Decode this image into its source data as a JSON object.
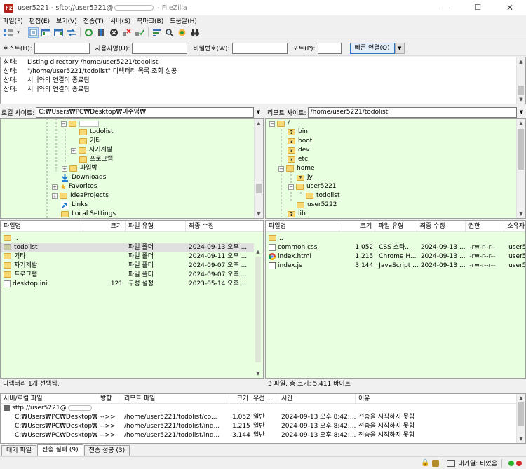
{
  "window": {
    "title_prefix": "user5221 - sftp://user5221@",
    "title_suffix": " - FileZilla",
    "minimize": "—",
    "maximize": "☐",
    "close": "✕"
  },
  "menu": [
    "파일(F)",
    "편집(E)",
    "보기(V)",
    "전송(T)",
    "서버(S)",
    "북마크(B)",
    "도움말(H)"
  ],
  "toolbar_icons": [
    "site-manager-icon",
    "toggle-log-icon",
    "toggle-local-tree-icon",
    "toggle-remote-tree-icon",
    "toggle-queue-icon",
    "refresh-icon",
    "process-queue-icon",
    "cancel-icon",
    "disconnect-icon",
    "reconnect-icon",
    "directory-filter-icon",
    "search-icon",
    "compare-icon",
    "binoculars-icon"
  ],
  "quickconnect": {
    "host_label": "호스트(H):",
    "user_label": "사용자명(U):",
    "pass_label": "비밀번호(W):",
    "port_label": "포트(P):",
    "button": "빠른 연결(Q)"
  },
  "log": [
    {
      "k": "상태:",
      "v": "Listing directory /home/user5221/todolist"
    },
    {
      "k": "상태:",
      "v": "\"/home/user5221/todolist\" 디렉터리 목록 조회 성공"
    },
    {
      "k": "상태:",
      "v": "서버와의 연결이 종료됨"
    },
    {
      "k": "상태:",
      "v": "서버와의 연결이 종료됨"
    }
  ],
  "local": {
    "site_label": "로컬 사이트:",
    "site_path": "C:₩Users₩PC₩Desktop₩이주영₩",
    "tree": [
      {
        "label": "todolist",
        "icon": "folder"
      },
      {
        "label": "기타",
        "icon": "folder"
      },
      {
        "label": "자기계발",
        "icon": "folder"
      },
      {
        "label": "프로그램",
        "icon": "folder"
      },
      {
        "label": "파일방",
        "icon": "folder"
      },
      {
        "label": "Downloads",
        "icon": "downloads"
      },
      {
        "label": "Favorites",
        "icon": "favorites"
      },
      {
        "label": "IdeaProjects",
        "icon": "folder"
      },
      {
        "label": "Links",
        "icon": "links"
      },
      {
        "label": "Local Settings",
        "icon": "folder"
      }
    ],
    "columns": [
      "파일명",
      "크기",
      "파일 유형",
      "최종 수정"
    ],
    "files": [
      {
        "name": "..",
        "size": "",
        "type": "",
        "modified": ""
      },
      {
        "name": "todolist",
        "size": "",
        "type": "파일 폴더",
        "modified": "2024-09-13 오후 ..."
      },
      {
        "name": "기타",
        "size": "",
        "type": "파일 폴더",
        "modified": "2024-09-11 오후 ..."
      },
      {
        "name": "자기계발",
        "size": "",
        "type": "파일 폴더",
        "modified": "2024-09-07 오후 ..."
      },
      {
        "name": "프로그램",
        "size": "",
        "type": "파일 폴더",
        "modified": "2024-09-07 오후 ..."
      },
      {
        "name": "desktop.ini",
        "size": "121",
        "type": "구성 설정",
        "modified": "2023-05-14 오후 ..."
      }
    ],
    "status": "디렉터리 1개 선택됨."
  },
  "remote": {
    "site_label": "리모트 사이트:",
    "site_path": "/home/user5221/todolist",
    "tree": [
      {
        "label": "/",
        "icon": "folder"
      },
      {
        "label": "bin",
        "icon": "folder-unknown"
      },
      {
        "label": "boot",
        "icon": "folder-unknown"
      },
      {
        "label": "dev",
        "icon": "folder-unknown"
      },
      {
        "label": "etc",
        "icon": "folder-unknown"
      },
      {
        "label": "home",
        "icon": "folder"
      },
      {
        "label": "jy",
        "icon": "folder-unknown"
      },
      {
        "label": "user5221",
        "icon": "folder"
      },
      {
        "label": "todolist",
        "icon": "folder"
      },
      {
        "label": "user5222",
        "icon": "folder"
      },
      {
        "label": "lib",
        "icon": "folder-unknown"
      }
    ],
    "columns": [
      "파일명",
      "크기",
      "파일 유형",
      "최종 수정",
      "권한",
      "소유자"
    ],
    "files": [
      {
        "name": "..",
        "size": "",
        "type": "",
        "modified": "",
        "perm": "",
        "owner": ""
      },
      {
        "name": "common.css",
        "size": "1,052",
        "type": "CSS 스타...",
        "modified": "2024-09-13 ...",
        "perm": "-rw-r--r--",
        "owner": "user5..."
      },
      {
        "name": "index.html",
        "size": "1,215",
        "type": "Chrome H...",
        "modified": "2024-09-13 ...",
        "perm": "-rw-r--r--",
        "owner": "user5..."
      },
      {
        "name": "index.js",
        "size": "3,144",
        "type": "JavaScript ...",
        "modified": "2024-09-13 ...",
        "perm": "-rw-r--r--",
        "owner": "user5..."
      }
    ],
    "status": "3 파일. 총 크기: 5,411 바이트"
  },
  "queue": {
    "columns": [
      "서버/로컬 파일",
      "방향",
      "리모트 파일",
      "크기",
      "우선 ...",
      "시간",
      "이유"
    ],
    "server": "sftp://user5221@",
    "rows": [
      {
        "local": "C:₩Users₩PC₩Desktop₩...",
        "dir": "-->>",
        "remote": "/home/user5221/todolist/co...",
        "size": "1,052",
        "prio": "일반",
        "time": "2024-09-13 오후 8:42:...",
        "reason": "전송을 시작하지 못함"
      },
      {
        "local": "C:₩Users₩PC₩Desktop₩...",
        "dir": "-->>",
        "remote": "/home/user5221/todolist/ind...",
        "size": "1,215",
        "prio": "일반",
        "time": "2024-09-13 오후 8:42:...",
        "reason": "전송을 시작하지 못함"
      },
      {
        "local": "C:₩Users₩PC₩Desktop₩...",
        "dir": "-->>",
        "remote": "/home/user5221/todolist/ind...",
        "size": "3,144",
        "prio": "일반",
        "time": "2024-09-13 오후 8:42:...",
        "reason": "전송을 시작하지 못함"
      }
    ]
  },
  "tabs": [
    "대기 파일",
    "전송 실패 (9)",
    "전송 성공 (3)"
  ],
  "statusbar": {
    "queue_label": "대기열: 비었음",
    "colors": {
      "green": "#2bb32b",
      "red": "#d42a2a"
    }
  },
  "colors": {
    "pane_bg": "#e8ffe0",
    "folder": "#f8d775"
  }
}
